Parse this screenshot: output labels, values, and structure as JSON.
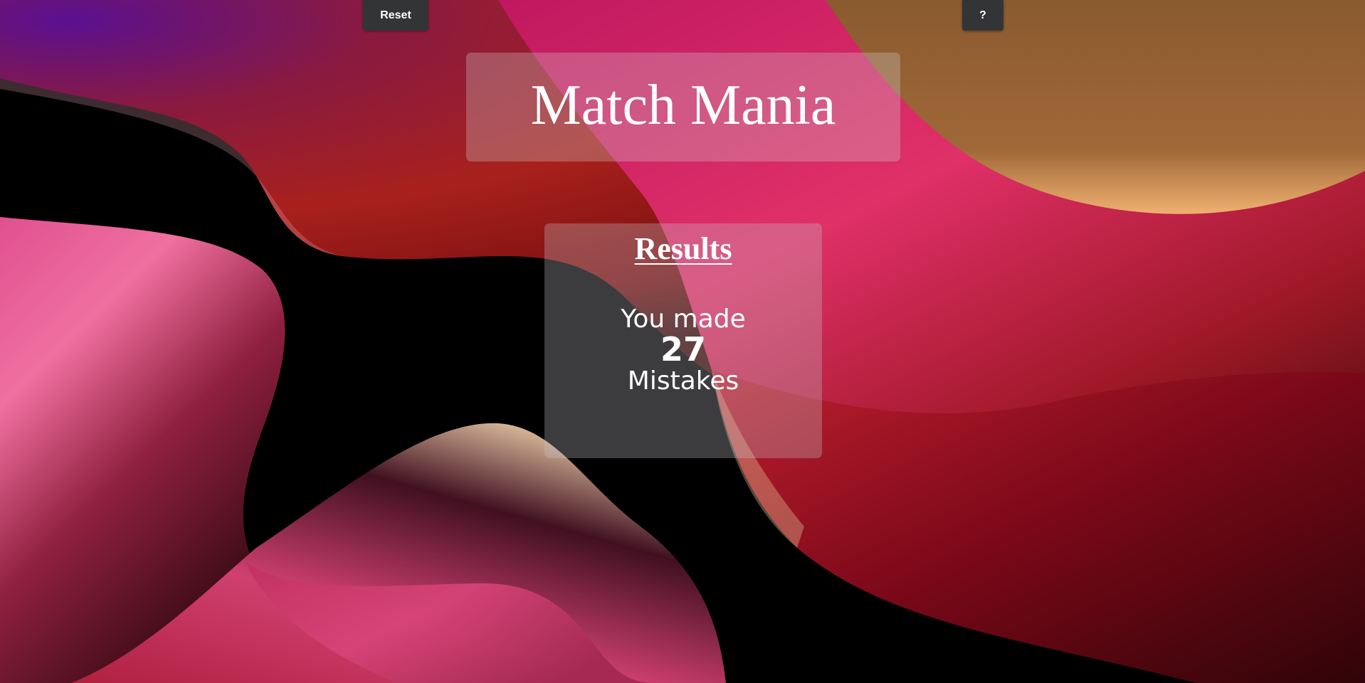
{
  "toolbar": {
    "reset_label": "Reset",
    "help_label": "?"
  },
  "header": {
    "title": "Match Mania"
  },
  "results": {
    "heading": "Results",
    "prefix": "You made",
    "mistakes": "27",
    "suffix": "Mistakes"
  },
  "theme": {
    "button_bg": "#333436",
    "panel_tint": "rgba(210,210,210,0.30)",
    "text_color": "#ffffff",
    "wallpaper_colors": [
      "#000000",
      "#e0305f",
      "#a01a1a",
      "#e8a060",
      "#5a1080",
      "#f06a9a"
    ]
  }
}
